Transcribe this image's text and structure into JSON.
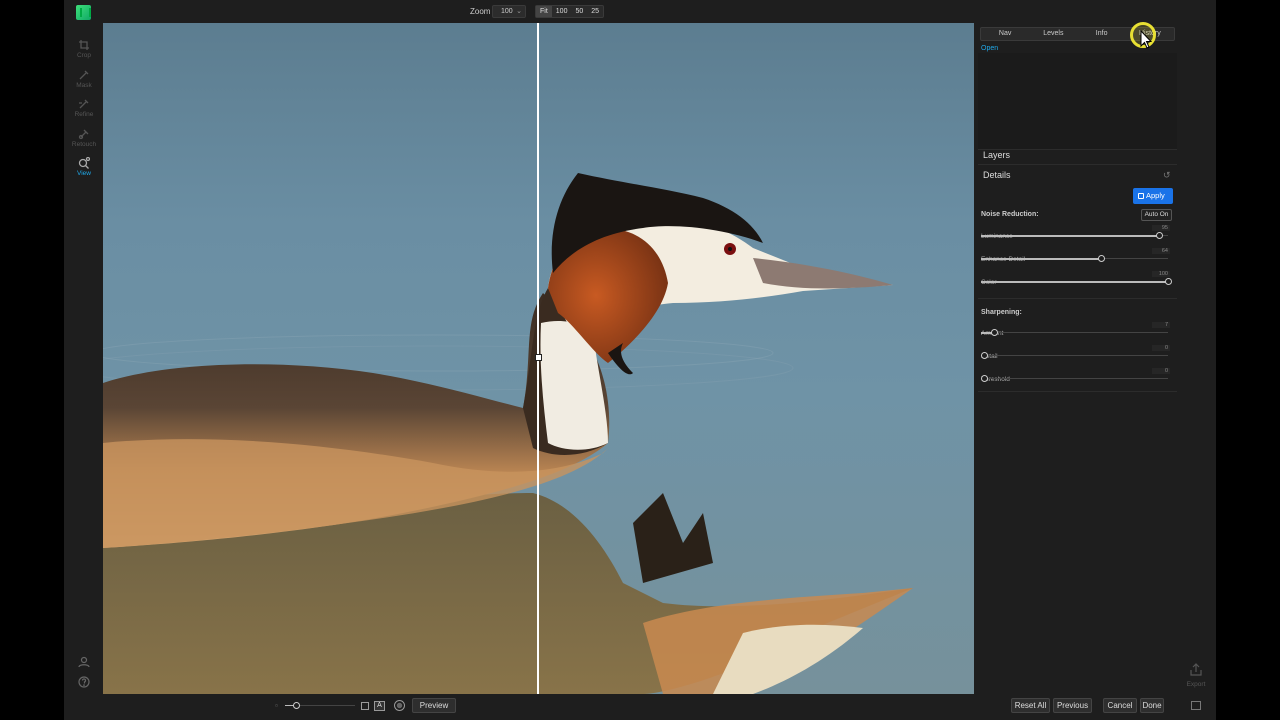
{
  "toolbar": {
    "zoom_label": "Zoom",
    "zoom_value": "100",
    "zoom_presets": [
      "Fit",
      "100",
      "50",
      "25"
    ]
  },
  "tools": [
    {
      "label": "Crop",
      "icon": "crop-icon"
    },
    {
      "label": "Mask",
      "icon": "brush-icon"
    },
    {
      "label": "Refine",
      "icon": "refine-brush-icon"
    },
    {
      "label": "Retouch",
      "icon": "retouch-icon"
    },
    {
      "label": "View",
      "icon": "magnifier-icon",
      "active": true
    }
  ],
  "panel": {
    "tabs": [
      "Nav",
      "Levels",
      "Info",
      "History"
    ],
    "history_items": [
      "Open"
    ],
    "layers_title": "Layers",
    "details_title": "Details",
    "apply_label": "Apply",
    "noise_reduction": {
      "title": "Noise Reduction:",
      "auto_label": "Auto On",
      "sliders": [
        {
          "name": "Luminance",
          "value": 95
        },
        {
          "name": "Enhance Detail",
          "value": 64
        },
        {
          "name": "Color",
          "value": 100
        }
      ]
    },
    "sharpening": {
      "title": "Sharpening:",
      "sliders": [
        {
          "name": "Amount",
          "value": 7
        },
        {
          "name": "Detail",
          "value": 0
        },
        {
          "name": "Threshold",
          "value": 0
        }
      ]
    }
  },
  "bottom": {
    "preview_label": "Preview",
    "reset_all_label": "Reset All",
    "previous_label": "Previous",
    "cancel_label": "Cancel",
    "done_label": "Done",
    "export_label": "Export"
  },
  "colors": {
    "accent": "#1fa8e8",
    "apply_blue": "#1a73e8",
    "cursor_highlight": "#e8e033"
  }
}
